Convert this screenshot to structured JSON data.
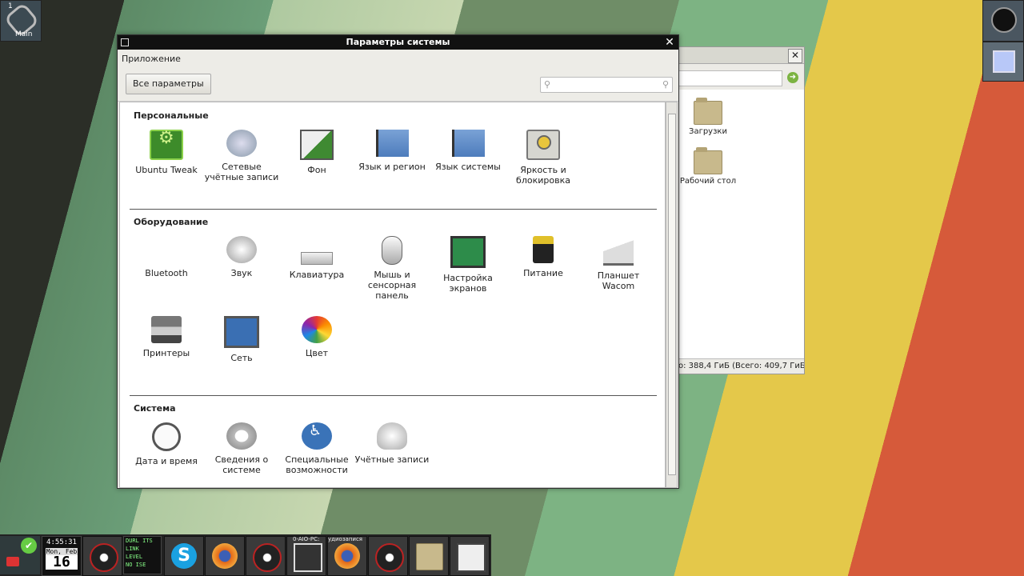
{
  "workspace": {
    "number": "1",
    "label": "Main"
  },
  "file_manager": {
    "folders": [
      {
        "label": "Загрузки"
      },
      {
        "label": "Рабочий стол"
      }
    ],
    "status": "о: 388,4 ГиБ (Всего: 409,7 ГиБ)"
  },
  "window": {
    "title": "Параметры системы",
    "menu": "Приложение",
    "all_settings_label": "Все параметры",
    "search": {
      "placeholder": "",
      "value": ""
    }
  },
  "sections": {
    "personal": {
      "title": "Персональные",
      "items": [
        {
          "label": "Ubuntu Tweak",
          "icon": "ubuntu-tweak-icon"
        },
        {
          "label": "Сетевые учётные записи",
          "icon": "online-accounts-icon"
        },
        {
          "label": "Фон",
          "icon": "background-icon"
        },
        {
          "label": "Язык и регион",
          "icon": "flag-icon"
        },
        {
          "label": "Язык системы",
          "icon": "flag-icon"
        },
        {
          "label": "Яркость и блокировка",
          "icon": "brightness-icon"
        }
      ]
    },
    "hardware": {
      "title": "Оборудование",
      "items": [
        {
          "label": "Bluetooth",
          "icon": "bluetooth-icon"
        },
        {
          "label": "Звук",
          "icon": "sound-icon"
        },
        {
          "label": "Клавиатура",
          "icon": "keyboard-icon"
        },
        {
          "label": "Мышь и сенсорная панель",
          "icon": "mouse-icon"
        },
        {
          "label": "Настройка экранов",
          "icon": "display-icon"
        },
        {
          "label": "Питание",
          "icon": "power-icon"
        },
        {
          "label": "Планшет Wacom",
          "icon": "wacom-icon"
        },
        {
          "label": "Принтеры",
          "icon": "printer-icon"
        },
        {
          "label": "Сеть",
          "icon": "network-icon"
        },
        {
          "label": "Цвет",
          "icon": "color-icon"
        }
      ]
    },
    "system": {
      "title": "Система",
      "items": [
        {
          "label": "Дата и время",
          "icon": "clock-icon"
        },
        {
          "label": "Сведения о системе",
          "icon": "system-info-icon"
        },
        {
          "label": "Специальные возможности",
          "icon": "accessibility-icon"
        },
        {
          "label": "Учётные записи",
          "icon": "users-icon"
        }
      ]
    }
  },
  "taskbar": {
    "clock_time": "4:55:31",
    "clock_date": "Mon, Feb",
    "clock_day": "16",
    "monitor_lines": [
      "DURL ITS",
      "LINK",
      "LEVEL",
      "NO ISE"
    ],
    "label_pc": "0-AIO-PC:",
    "label_rec": "удиозапися"
  }
}
